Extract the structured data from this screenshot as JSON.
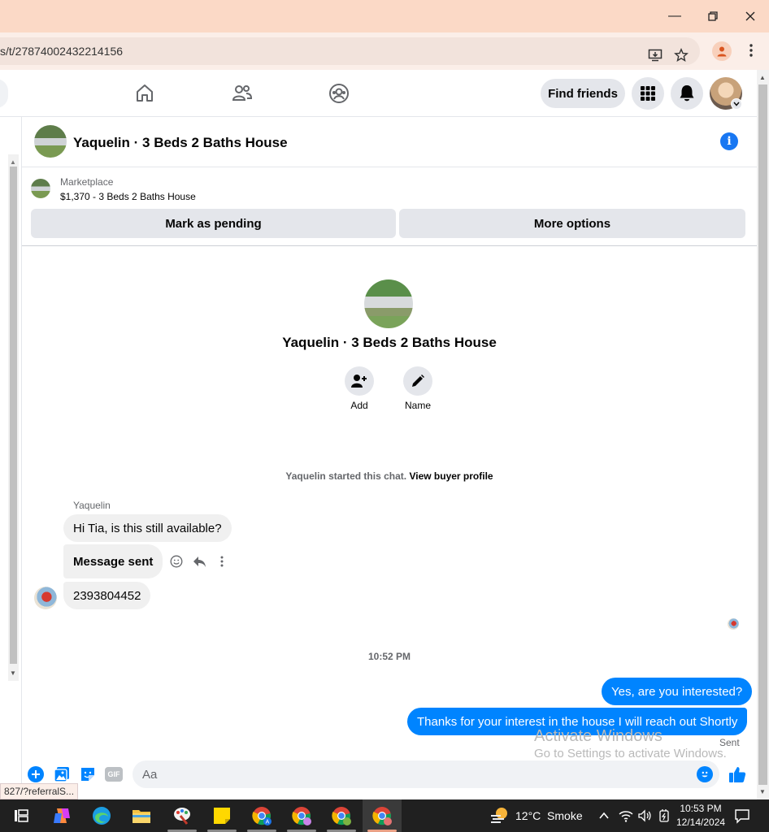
{
  "browser": {
    "url_fragment": "s/t/27874002432214156",
    "status_url": "827/?referralS..."
  },
  "header": {
    "find_friends_label": "Find friends"
  },
  "chat": {
    "title": "Yaquelin · 3 Beds 2 Baths House",
    "marketplace_label": "Marketplace",
    "listing": "$1,370 - 3 Beds 2 Baths House",
    "mark_pending_label": "Mark as pending",
    "more_options_label": "More options",
    "profile_name": "Yaquelin · 3 Beds 2 Baths House",
    "add_label": "Add",
    "name_label": "Name",
    "started_text": "Yaquelin started this chat.",
    "view_profile_label": "View buyer profile",
    "sender_name": "Yaquelin",
    "messages_in": [
      "Hi Tia, is this still available?",
      "Message sent",
      "2393804452"
    ],
    "time_divider": "10:52 PM",
    "messages_out": [
      "Yes, are you interested?",
      "Thanks for your interest in the house I will reach out Shortly"
    ],
    "sent_status": "Sent",
    "composer_placeholder": "Aa"
  },
  "watermark": {
    "line1": "Activate Windows",
    "line2": "Go to Settings to activate Windows."
  },
  "taskbar": {
    "weather": "12°C  Smoke",
    "time": "10:53 PM",
    "date": "12/14/2024"
  },
  "colors": {
    "messenger_blue": "#0084ff",
    "fb_blue": "#1877f2",
    "titlebar": "#fbd9c6"
  }
}
